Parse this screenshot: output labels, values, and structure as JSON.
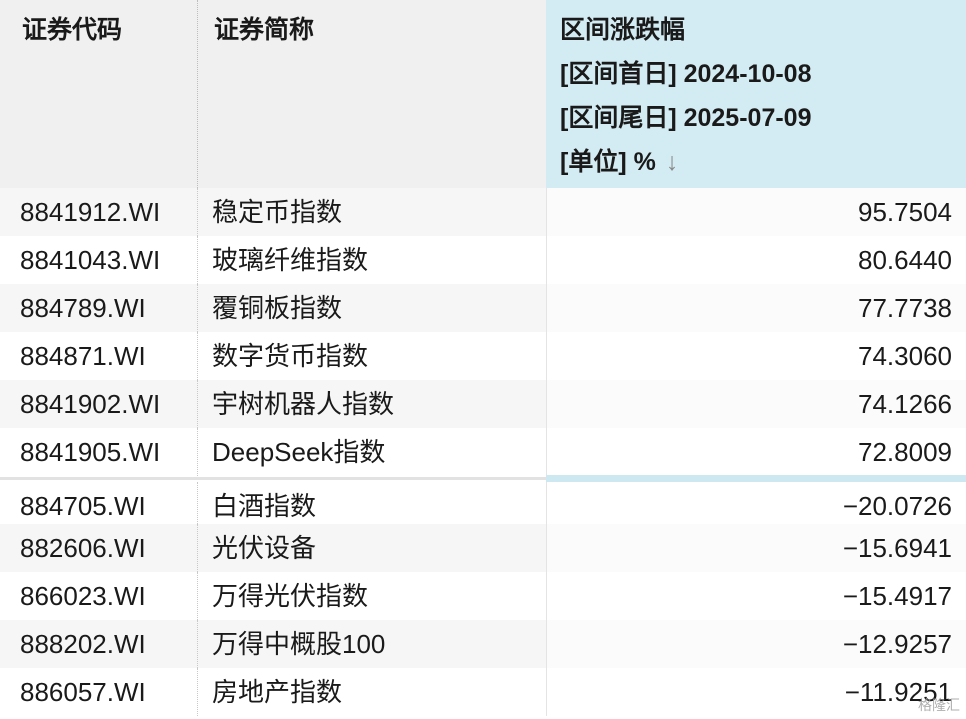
{
  "header": {
    "code_label": "证券代码",
    "name_label": "证券简称",
    "change_title": "区间涨跌幅",
    "start_date_line": "[区间首日] 2024-10-08",
    "end_date_line": "[区间尾日] 2025-07-09",
    "unit_line": "[单位] %",
    "sort_arrow": "↓"
  },
  "rows": [
    {
      "code": "8841912.WI",
      "name": "稳定币指数",
      "change": "95.7504"
    },
    {
      "code": "8841043.WI",
      "name": "玻璃纤维指数",
      "change": "80.6440"
    },
    {
      "code": "884789.WI",
      "name": "覆铜板指数",
      "change": "77.7738"
    },
    {
      "code": "884871.WI",
      "name": "数字货币指数",
      "change": "74.3060"
    },
    {
      "code": "8841902.WI",
      "name": "宇树机器人指数",
      "change": "74.1266"
    },
    {
      "code": "8841905.WI",
      "name": "DeepSeek指数",
      "change": "72.8009"
    },
    {
      "code": "884705.WI",
      "name": "白酒指数",
      "change": "−20.0726"
    },
    {
      "code": "882606.WI",
      "name": "光伏设备",
      "change": "−15.6941"
    },
    {
      "code": "866023.WI",
      "name": "万得光伏指数",
      "change": "−15.4917"
    },
    {
      "code": "888202.WI",
      "name": "万得中概股100",
      "change": "−12.9257"
    },
    {
      "code": "886057.WI",
      "name": "房地产指数",
      "change": "−11.9251"
    }
  ],
  "watermark": "格隆汇"
}
